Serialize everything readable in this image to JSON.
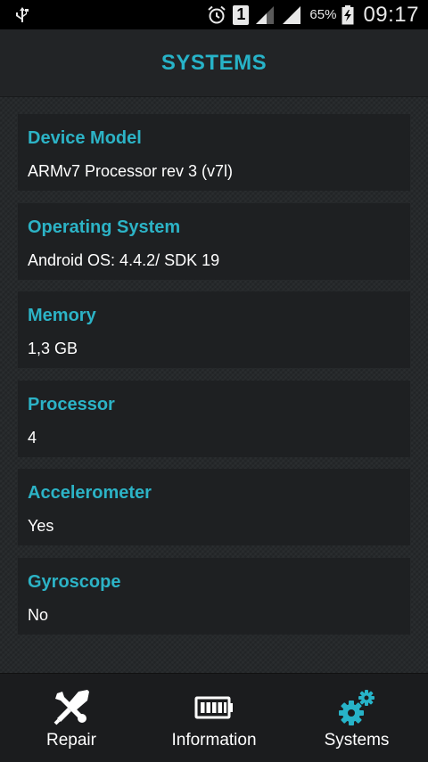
{
  "status_bar": {
    "sim_slot": "1",
    "battery_percent": "65%",
    "time": "09:17",
    "icons": [
      "usb-icon",
      "alarm-icon",
      "sim-icon",
      "signal-icon",
      "signal-icon",
      "battery-charging-icon"
    ]
  },
  "header": {
    "title": "SYSTEMS"
  },
  "cards": [
    {
      "title": "Device Model",
      "value": "ARMv7 Processor rev 3 (v7l)"
    },
    {
      "title": "Operating System",
      "value": "Android OS: 4.4.2/ SDK 19"
    },
    {
      "title": "Memory",
      "value": "1,3 GB"
    },
    {
      "title": "Processor",
      "value": "4"
    },
    {
      "title": "Accelerometer",
      "value": "Yes"
    },
    {
      "title": "Gyroscope",
      "value": "No"
    }
  ],
  "nav": [
    {
      "label": "Repair",
      "icon": "tools-icon"
    },
    {
      "label": "Information",
      "icon": "battery-icon"
    },
    {
      "label": "Systems",
      "icon": "gears-icon"
    }
  ],
  "colors": {
    "accent": "#27b3c8",
    "background": "#26292b",
    "card": "#1e2022"
  }
}
